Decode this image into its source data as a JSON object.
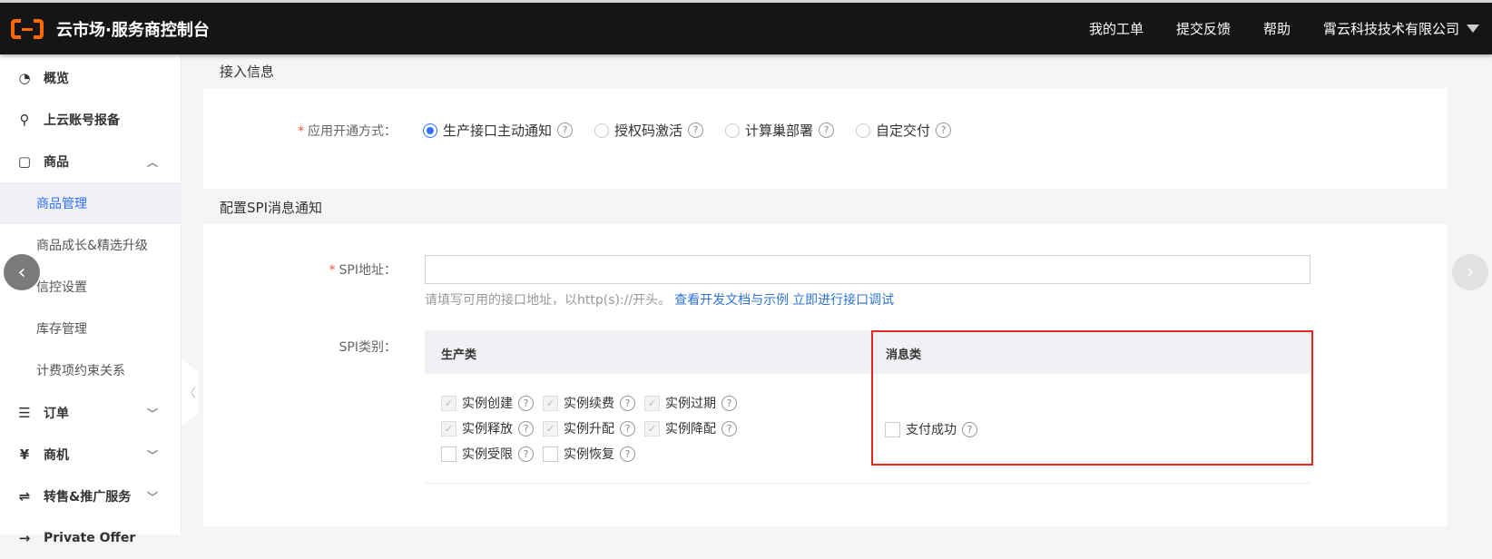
{
  "header": {
    "brand": "云市场·服务商控制台",
    "nav": [
      "我的工单",
      "提交反馈",
      "帮助"
    ],
    "account": "霄云科技技术有限公司"
  },
  "sidebar": {
    "items": [
      {
        "label": "概览",
        "icon": "pie-chart-icon"
      },
      {
        "label": "上云账号报备",
        "icon": "user-icon"
      },
      {
        "label": "商品",
        "icon": "bag-icon"
      },
      {
        "label": "商品管理"
      },
      {
        "label": "商品成长&精选升级"
      },
      {
        "label": "信控设置"
      },
      {
        "label": "库存管理"
      },
      {
        "label": "计费项约束关系"
      },
      {
        "label": "订单",
        "icon": "document-icon"
      },
      {
        "label": "商机",
        "icon": "yen-icon"
      },
      {
        "label": "转售&推广服务",
        "icon": "swap-icon"
      },
      {
        "label": "Private Offer"
      }
    ]
  },
  "access": {
    "title": "接入信息",
    "label": "应用开通方式：",
    "options": [
      "生产接口主动通知",
      "授权码激活",
      "计算巢部署",
      "自定交付"
    ],
    "selected": "生产接口主动通知"
  },
  "spi": {
    "title": "配置SPI消息通知",
    "address_label": "SPI地址：",
    "address_value": "",
    "help": "请填写可用的接口地址，以http(s)://开头。",
    "doc_link": "查看开发文档与示例",
    "debug_link": "立即进行接口调试",
    "type_label": "SPI类别：",
    "production": {
      "title": "生产类",
      "items": [
        {
          "label": "实例创建",
          "checked": true,
          "disabled": true
        },
        {
          "label": "实例续费",
          "checked": true,
          "disabled": true
        },
        {
          "label": "实例过期",
          "checked": true,
          "disabled": true
        },
        {
          "label": "实例释放",
          "checked": true,
          "disabled": true
        },
        {
          "label": "实例升配",
          "checked": true,
          "disabled": true
        },
        {
          "label": "实例降配",
          "checked": true,
          "disabled": true
        },
        {
          "label": "实例受限",
          "checked": false,
          "disabled": false
        },
        {
          "label": "实例恢复",
          "checked": false,
          "disabled": false
        }
      ]
    },
    "message": {
      "title": "消息类",
      "items": [
        {
          "label": "支付成功",
          "checked": false
        }
      ]
    }
  },
  "colors": {
    "accent": "#3370ff",
    "highlight": "#e8281c",
    "topbar": "#151515"
  }
}
